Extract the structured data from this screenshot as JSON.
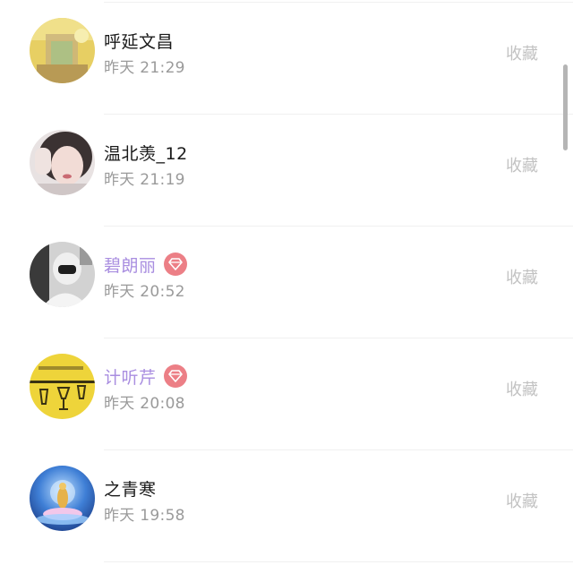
{
  "list": {
    "items": [
      {
        "name": "呼延文昌",
        "time": "昨天 21:29",
        "action": "收藏",
        "vip": false,
        "avatar_icon": "avatar-photo-icon"
      },
      {
        "name": "温北羡_12",
        "time": "昨天 21:19",
        "action": "收藏",
        "vip": false,
        "avatar_icon": "avatar-photo-icon"
      },
      {
        "name": "碧朗丽",
        "time": "昨天 20:52",
        "action": "收藏",
        "vip": true,
        "avatar_icon": "avatar-photo-icon"
      },
      {
        "name": "计听芹",
        "time": "昨天 20:08",
        "action": "收藏",
        "vip": true,
        "avatar_icon": "avatar-photo-icon"
      },
      {
        "name": "之青寒",
        "time": "昨天 19:58",
        "action": "收藏",
        "vip": false,
        "avatar_icon": "avatar-photo-icon"
      }
    ]
  },
  "colors": {
    "name_default": "#1a1a1a",
    "name_vip": "#a98ee0",
    "vip_badge": "#ec7f86",
    "time": "#9a9a9a",
    "action": "#c2c2c2"
  },
  "icons": {
    "vip": "diamond-icon"
  }
}
